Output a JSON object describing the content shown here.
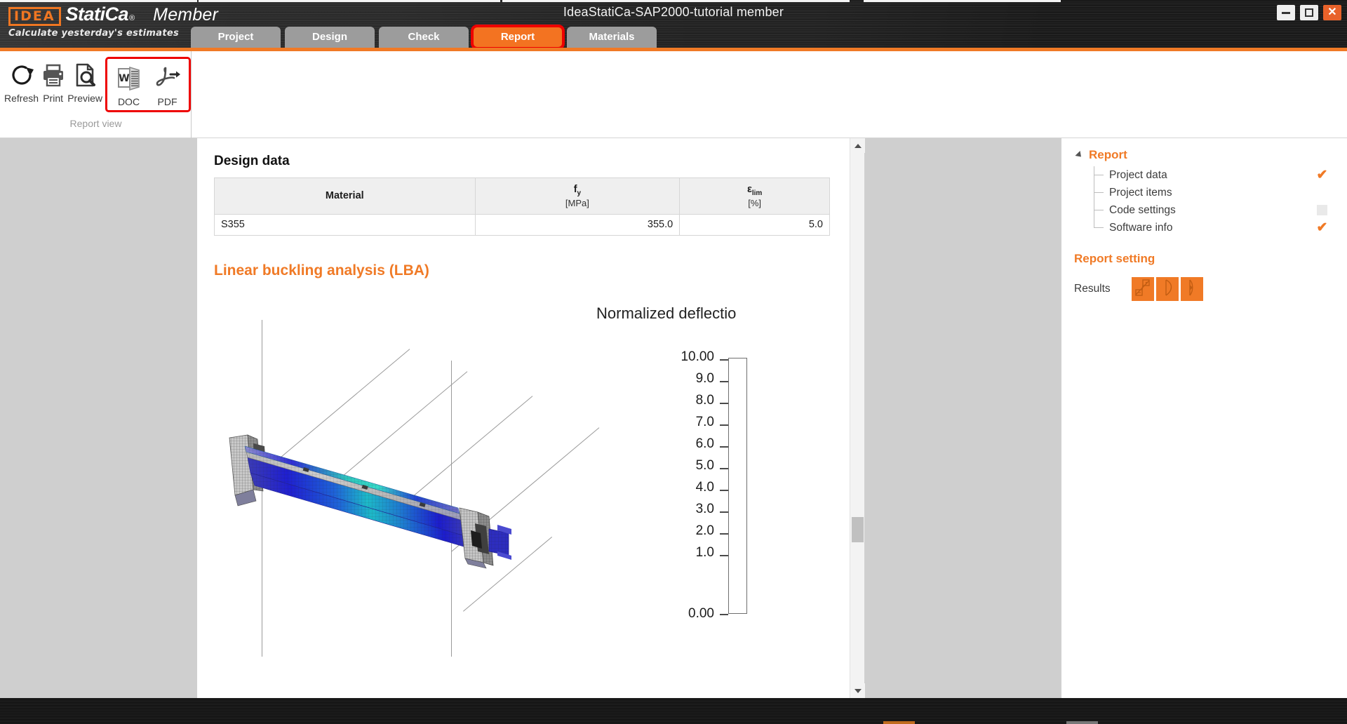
{
  "window": {
    "app_name_idea": "IDEA",
    "app_name_statica": "StatiCa",
    "registered_mark": "®",
    "product": "Member",
    "tagline": "Calculate yesterday's estimates",
    "document_title": "IdeaStatiCa-SAP2000-tutorial member",
    "controls": {
      "minimize": "minimize-button",
      "maximize": "maximize-button",
      "close": "✕"
    }
  },
  "tabs": [
    {
      "label": "Project",
      "active": false
    },
    {
      "label": "Design",
      "active": false
    },
    {
      "label": "Check",
      "active": false
    },
    {
      "label": "Report",
      "active": true
    },
    {
      "label": "Materials",
      "active": false
    }
  ],
  "ribbon": {
    "group_label": "Report view",
    "items": [
      {
        "label": "Refresh",
        "icon": "refresh-icon"
      },
      {
        "label": "Print",
        "icon": "printer-icon"
      },
      {
        "label": "Preview",
        "icon": "preview-magnifier-icon"
      },
      {
        "label": "DOC",
        "icon": "word-doc-icon"
      },
      {
        "label": "PDF",
        "icon": "pdf-icon"
      }
    ],
    "highlight_color": "#ee0000"
  },
  "report": {
    "design_data": {
      "title": "Design data",
      "columns": [
        {
          "name": "Material",
          "unit": ""
        },
        {
          "name": "fy",
          "sub": "y",
          "base": "f",
          "unit": "[MPa]"
        },
        {
          "name": "εlim",
          "sub": "lim",
          "base": "ε",
          "unit": "[%]"
        }
      ],
      "rows": [
        {
          "material": "S355",
          "fy": "355.0",
          "eps_lim": "5.0"
        }
      ]
    },
    "lba": {
      "title": "Linear buckling analysis (LBA)",
      "figure_caption": "Normalized deflectio"
    }
  },
  "chart_data": {
    "type": "heatmap",
    "title": "Normalized deflectio",
    "description": "Linear buckling analysis (LBA) 3D FEA beam result with normalized deflection colour map",
    "colorbar": {
      "min": 0.0,
      "max": 10.0,
      "tick_labels": [
        "10.00",
        "9.0",
        "8.0",
        "7.0",
        "6.0",
        "5.0",
        "4.0",
        "3.0",
        "2.0",
        "1.0",
        "0.00"
      ],
      "tick_values": [
        10.0,
        9.0,
        8.0,
        7.0,
        6.0,
        5.0,
        4.0,
        3.0,
        2.0,
        1.0,
        0.0
      ],
      "orientation": "vertical",
      "colors_low_to_high": [
        "#d6d6d6",
        "#a9a9f2",
        "#6a5ce8",
        "#1a1ae0",
        "#2060ee",
        "#45a8f5",
        "#3ee2ee",
        "#16c79a",
        "#0a8f4a",
        "#128019",
        "#5ba81a",
        "#b8d21a",
        "#f3ed1a",
        "#f8c81a",
        "#f9a11a",
        "#f77a14",
        "#f03e10",
        "#ee0f0f",
        "#c00808"
      ]
    },
    "grid": false,
    "legend_position": "right"
  },
  "side_panel": {
    "tree": {
      "root_label": "Report",
      "items": [
        {
          "label": "Project data",
          "state": "checked"
        },
        {
          "label": "Project items",
          "state": "none"
        },
        {
          "label": "Code settings",
          "state": "unchecked"
        },
        {
          "label": "Software info",
          "state": "checked"
        }
      ]
    },
    "report_setting": {
      "title": "Report setting",
      "results_label": "Results",
      "buttons": [
        {
          "name": "results-view-1",
          "icon": "member-diagram-icon"
        },
        {
          "name": "results-view-2",
          "icon": "buckling-curve-icon"
        },
        {
          "name": "results-view-3",
          "icon": "section-deflection-icon"
        }
      ]
    },
    "accent_color": "#f07a26"
  }
}
